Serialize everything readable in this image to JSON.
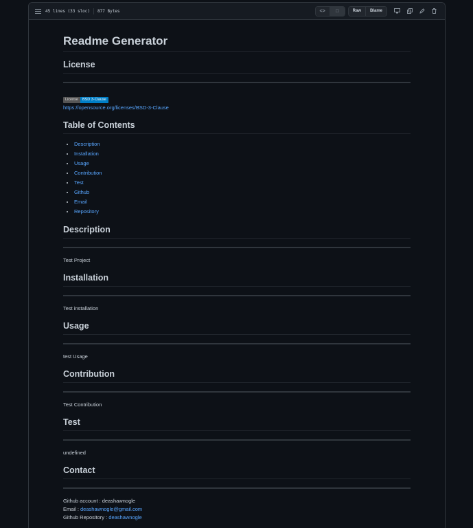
{
  "file_meta": {
    "lines": "45 lines (33 sloc)",
    "size": "877 Bytes"
  },
  "toolbar": {
    "code_icon": "code-icon",
    "preview_icon": "file-icon",
    "raw_label": "Raw",
    "blame_label": "Blame",
    "icons": [
      "desktop-icon",
      "copy-icon",
      "pencil-icon",
      "trash-icon"
    ]
  },
  "doc": {
    "title": "Readme Generator",
    "license": {
      "heading": "License",
      "badge_left": "License",
      "badge_right": "BSD 3-Clause",
      "link": "https://opensource.org/licenses/BSD-3-Clause"
    },
    "toc": {
      "heading": "Table of Contents",
      "items": [
        "Description",
        "Installation",
        "Usage",
        "Contribution",
        "Test",
        "Github",
        "Email",
        "Repository"
      ]
    },
    "description": {
      "heading": "Description",
      "text": "Test Project"
    },
    "installation": {
      "heading": "Installation",
      "text": "Test installation"
    },
    "usage": {
      "heading": "Usage",
      "text": "test Usage"
    },
    "contribution": {
      "heading": "Contribution",
      "text": "Test Contribution"
    },
    "test": {
      "heading": "Test",
      "text": "undefined"
    },
    "contact": {
      "heading": "Contact",
      "github_label": "Github account : deashawnogle",
      "email_label": "Email : ",
      "email": "deashawnogle@gmail.com",
      "repo_label": "Github Repository : ",
      "repo": "deashawnogle"
    }
  },
  "colors": {
    "background": "#0d1117",
    "link": "#58a6ff",
    "badge_blue": "#007ec6"
  }
}
